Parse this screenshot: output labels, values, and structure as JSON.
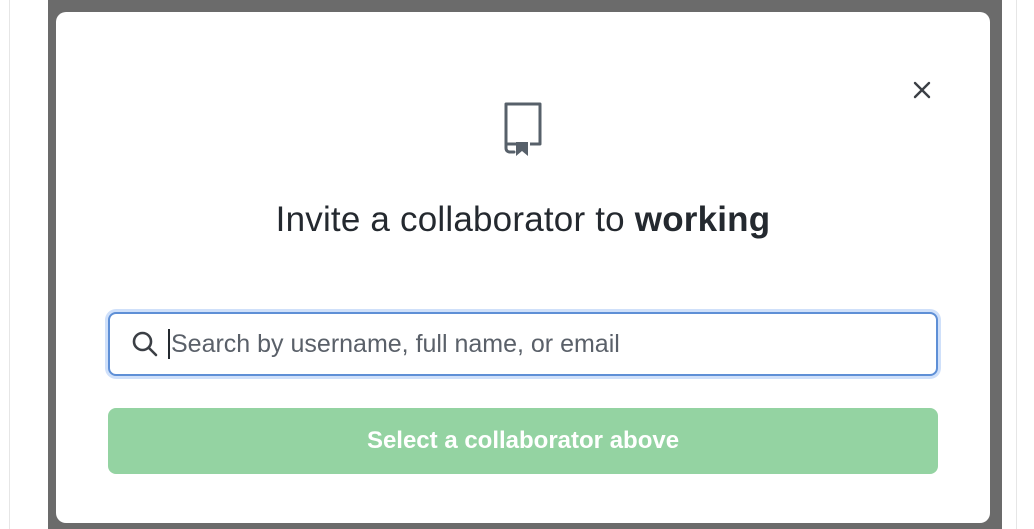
{
  "dialog": {
    "title_prefix": "Invite a collaborator to",
    "repo_name": "working",
    "close_label": "×",
    "icons": {
      "header": "repo-icon",
      "search": "search-icon",
      "close": "close-icon"
    }
  },
  "search": {
    "value": "",
    "placeholder": "Search by username, full name, or email"
  },
  "submit": {
    "label": "Select a collaborator above",
    "disabled": true
  },
  "colors": {
    "button_bg": "#94d3a2",
    "focus_border": "#5e8fd6",
    "backdrop": "#6b6b6b"
  }
}
